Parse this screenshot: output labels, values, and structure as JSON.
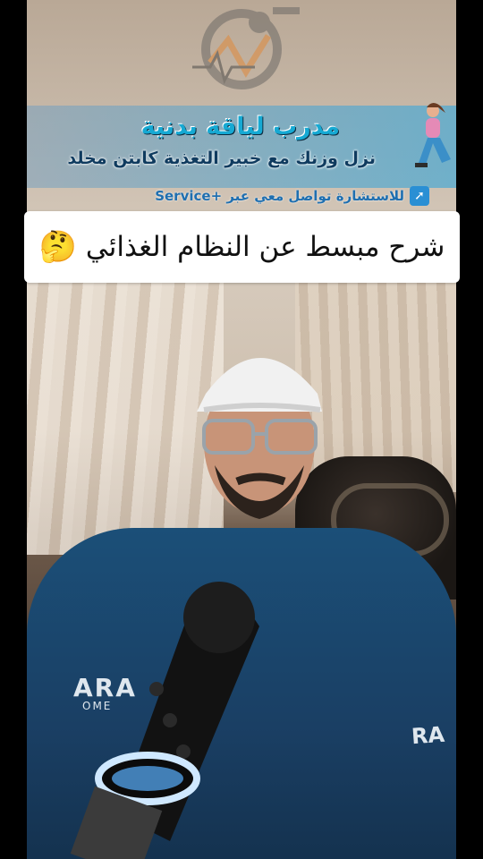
{
  "header": {
    "title": "مدرب لياقة بدنية",
    "subtitle": "نزل وزنك مع خبير التغذية كابتن مخلد",
    "consult_text": "للاستشارة تواصل معي عبر +Service",
    "badge_icon": "arrow-up-right-icon"
  },
  "caption": {
    "text": "شرح مبسط عن النظام الغذائي",
    "emoji": "🤔"
  },
  "shirt": {
    "logo_left": "ARA",
    "logo_left_sub": "OME",
    "logo_right": "RA"
  },
  "colors": {
    "title_blue": "#16a9d3",
    "subtitle_navy": "#0f3b5f",
    "shirt_blue": "#1b4f78",
    "caption_bg": "#ffffff"
  }
}
